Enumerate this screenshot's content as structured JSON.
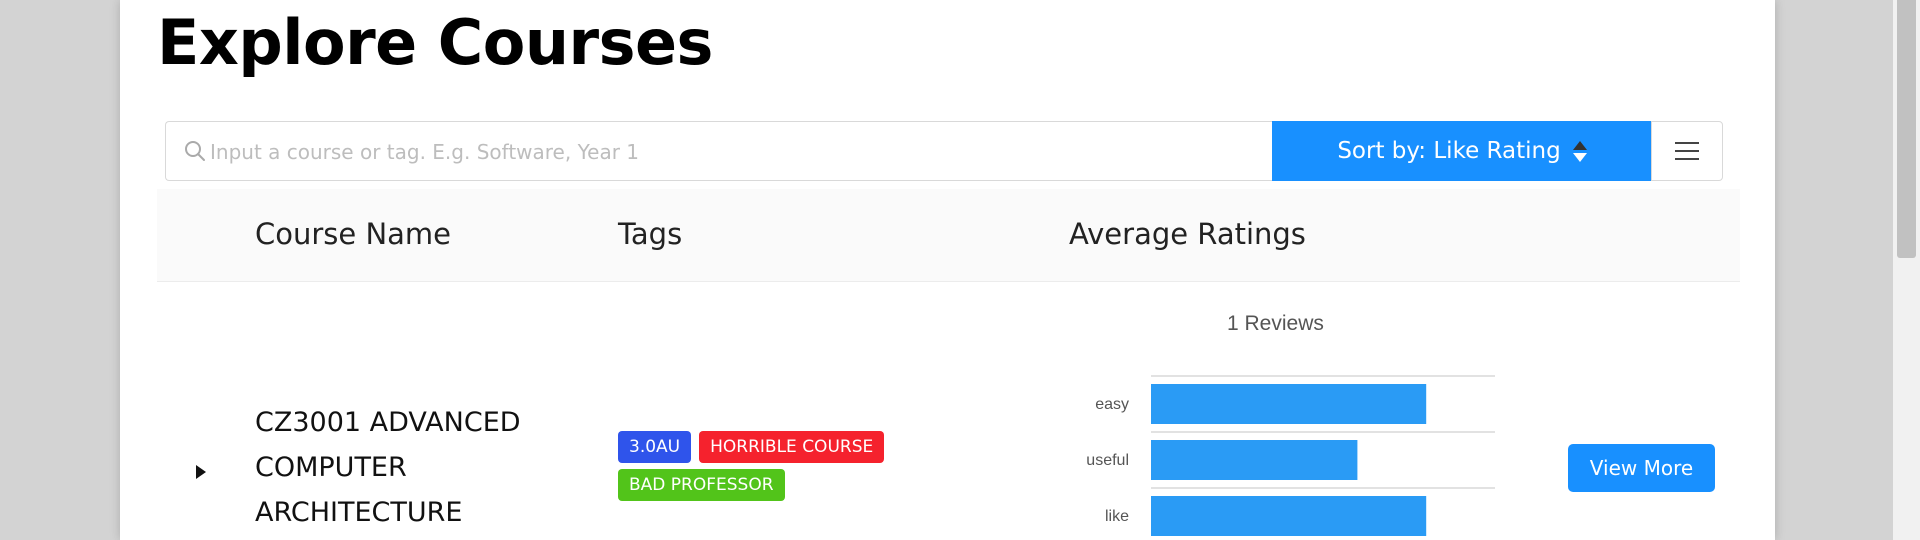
{
  "page": {
    "title": "Explore Courses"
  },
  "search": {
    "placeholder": "Input a course or tag. E.g. Software, Year 1",
    "value": ""
  },
  "sort": {
    "label": "Sort by: Like Rating"
  },
  "table": {
    "columns": [
      "Course Name",
      "Tags",
      "Average Ratings"
    ],
    "rows": [
      {
        "course_name": "CZ3001 ADVANCED COMPUTER ARCHITECTURE",
        "tags": [
          {
            "label": "3.0AU",
            "color": "#2f54eb"
          },
          {
            "label": "HORRIBLE COURSE",
            "color": "#f5222d"
          },
          {
            "label": "BAD PROFESSOR",
            "color": "#52c41a"
          }
        ],
        "reviews": "1 Reviews",
        "view_more": "View More"
      }
    ]
  },
  "chart_data": {
    "type": "bar",
    "orientation": "horizontal",
    "categories": [
      "easy",
      "useful",
      "like"
    ],
    "values": [
      4,
      3,
      4
    ],
    "xlim": [
      0,
      5
    ],
    "bar_color": "#2a9bf5",
    "grid": true
  },
  "colors": {
    "primary": "#1890ff",
    "background": "#d3d3d3"
  }
}
